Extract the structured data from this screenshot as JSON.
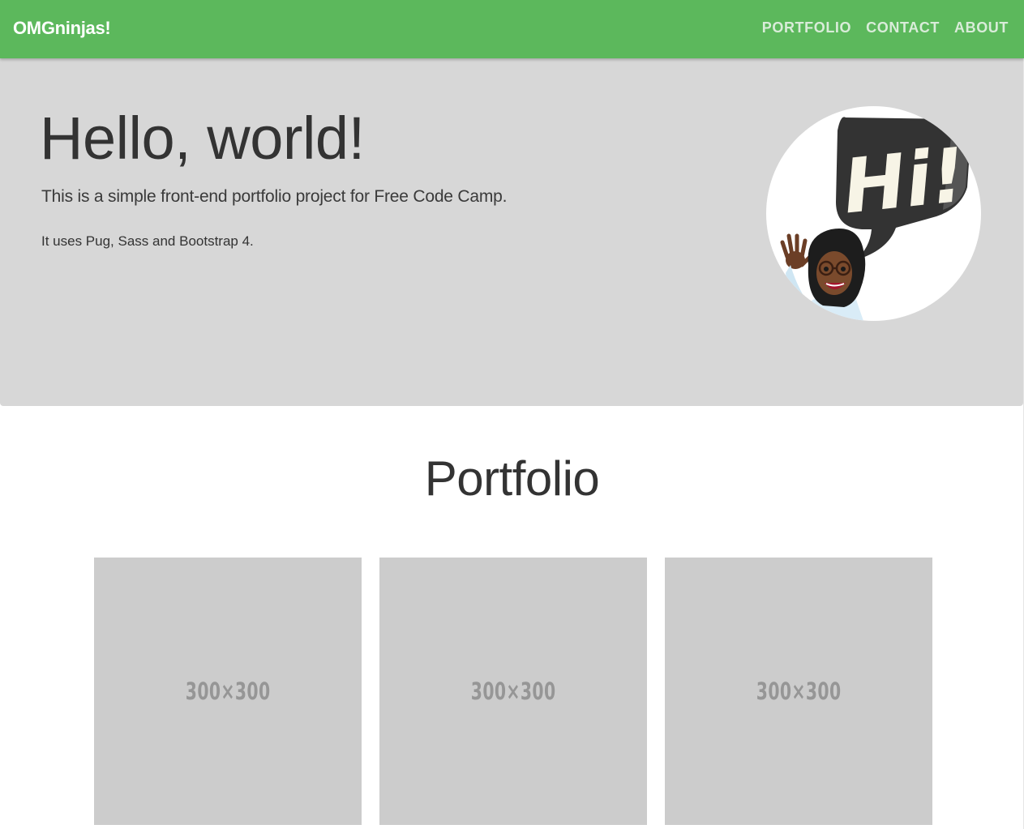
{
  "navbar": {
    "brand": "OMGninjas!",
    "links": [
      "PORTFOLIO",
      "CONTACT",
      "ABOUT"
    ]
  },
  "jumbotron": {
    "title": "Hello, world!",
    "lead": "This is a simple front-end portfolio project for Free Code Camp.",
    "text": "It uses Pug, Sass and Bootstrap 4.",
    "avatar_bubble_text": "Hi!"
  },
  "portfolio": {
    "title": "Portfolio",
    "items": [
      {
        "label": "300×300"
      },
      {
        "label": "300×300"
      },
      {
        "label": "300×300"
      }
    ]
  },
  "colors": {
    "navbar": "#5cb85c",
    "jumbotron": "#d7d7d7",
    "placeholder": "#cccccc"
  }
}
